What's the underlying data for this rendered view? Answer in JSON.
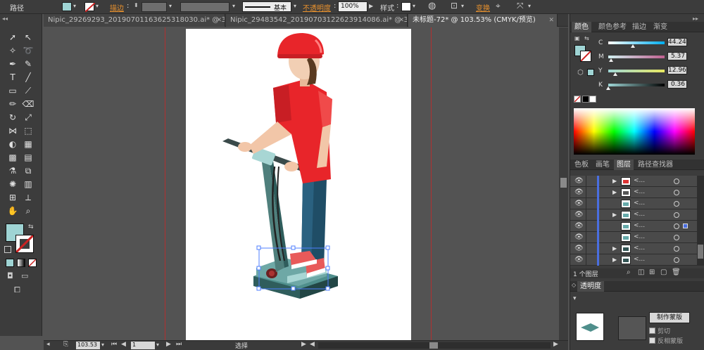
{
  "control_bar": {
    "object_type": "路径",
    "stroke_label": "描边",
    "opacity_label": "不透明度",
    "opacity_value": "100%",
    "brush_label": "基本",
    "style_label": "样式",
    "transform_label": "变换",
    "fill_color": "#9fd4d4",
    "stroke_color": "#cc2222"
  },
  "tabs": [
    {
      "label": "Nipic_29269293_20190701163625318030.ai* @ 33..."
    },
    {
      "label": "Nipic_29483542_20190703122623914086.ai* @ 33..."
    },
    {
      "label": "未标题-72* @ 103.53% (CMYK/预览)"
    }
  ],
  "status_bar": {
    "zoom": "103.53",
    "page": "1",
    "mode": "选择"
  },
  "color_panel": {
    "tabs": [
      "颜色",
      "颜色参考",
      "描边",
      "渐变"
    ],
    "channels": [
      {
        "name": "C",
        "value": "44.24",
        "level": 0.44
      },
      {
        "name": "M",
        "value": "5.37",
        "level": 0.05
      },
      {
        "name": "Y",
        "value": "12.96",
        "level": 0.13
      },
      {
        "name": "K",
        "value": "0.36",
        "level": 0.0
      }
    ]
  },
  "layers_panel": {
    "tabs": [
      "色板",
      "画笔",
      "图层",
      "路径查找器"
    ],
    "rows": [
      {
        "name": "<...",
        "expand": "▶"
      },
      {
        "name": "<...",
        "expand": "▶"
      },
      {
        "name": "<...",
        "expand": ""
      },
      {
        "name": "<...",
        "expand": "▶"
      },
      {
        "name": "<...",
        "expand": ""
      },
      {
        "name": "<...",
        "expand": ""
      },
      {
        "name": "<...",
        "expand": "▶"
      },
      {
        "name": "<...",
        "expand": "▶"
      }
    ],
    "footer": "1 个图层"
  },
  "transparency_panel": {
    "title": "透明度",
    "make_mask": "制作蒙版",
    "clip_label": "剪切",
    "invert_mask": "反相蒙版"
  }
}
